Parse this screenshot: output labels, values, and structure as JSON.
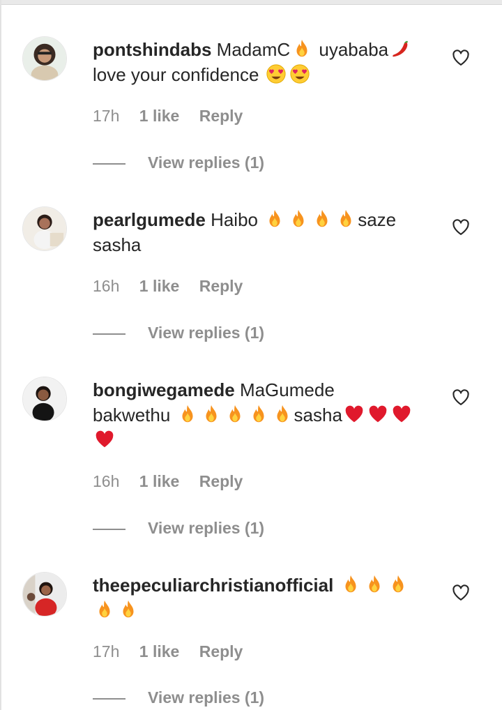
{
  "comments": [
    {
      "username": "pontshindabs",
      "text_part1": "MadamC",
      "text_part2": " uyababa",
      "text_part3": "love your confidence ",
      "time": "17h",
      "likes": "1 like",
      "reply": "Reply",
      "view_replies": "View replies (1)"
    },
    {
      "username": "pearlgumede",
      "text_part1": "Haibo ",
      "text_part2": "saze",
      "text_part3": "sasha",
      "time": "16h",
      "likes": "1 like",
      "reply": "Reply",
      "view_replies": "View replies (1)"
    },
    {
      "username": "bongiwegamede",
      "text_part1": "MaGumede",
      "text_part2": "bakwethu ",
      "text_part3": "sasha",
      "time": "16h",
      "likes": "1 like",
      "reply": "Reply",
      "view_replies": "View replies (1)"
    },
    {
      "username": "theepeculiarchristianofficial",
      "time": "17h",
      "likes": "1 like",
      "reply": "Reply",
      "view_replies": "View replies (1)"
    }
  ],
  "icons": {
    "like": "heart-outline-icon",
    "fire": "fire-emoji",
    "chili": "chili-pepper-emoji",
    "heart_eyes": "heart-eyes-emoji",
    "red_heart": "red-heart-emoji"
  },
  "colors": {
    "text": "#262626",
    "secondary": "#8e8e8e",
    "background": "#ffffff"
  }
}
